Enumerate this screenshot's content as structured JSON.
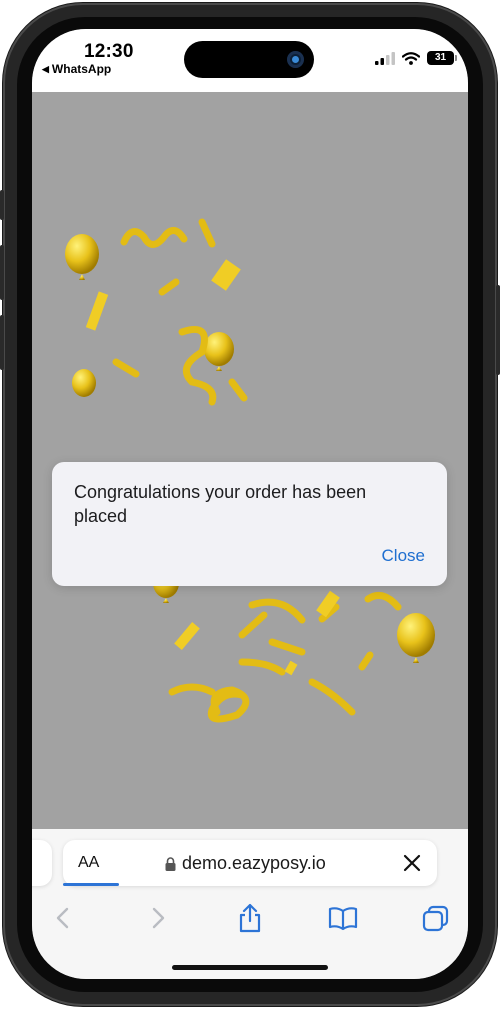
{
  "status_bar": {
    "time": "12:30",
    "back_app": "WhatsApp",
    "battery": "31"
  },
  "alert": {
    "message": "Congratulations your order has been placed",
    "close_label": "Close"
  },
  "address_bar": {
    "text_size_label": "AA",
    "url": "demo.eazyposy.io",
    "progress": 0.15
  },
  "toolbar": {
    "items": [
      "back-icon",
      "forward-icon",
      "share-icon",
      "bookmarks-icon",
      "tabs-icon"
    ]
  },
  "colors": {
    "link_blue": "#1f6fd0",
    "web_background": "#a2a2a2",
    "confetti_gold": "#e8c21a"
  }
}
